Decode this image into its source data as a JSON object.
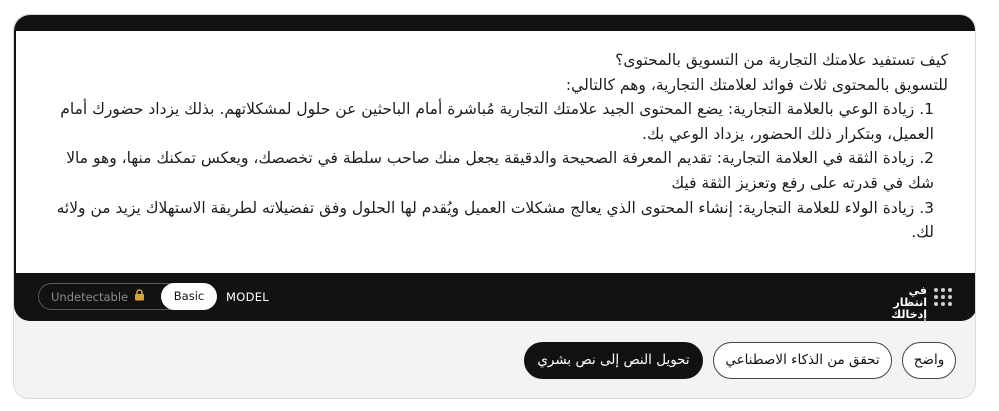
{
  "editor": {
    "paragraphs": [
      "كيف تستفيد علامتك التجارية من التسويق بالمحتوى؟",
      "للتسويق بالمحتوى ثلاث فوائد لعلامتك التجارية، وهم كالتالي:",
      "1. زيادة الوعي بالعلامة التجارية: يضع المحتوى الجيد علامتك التجارية مُباشرة أمام الباحثين عن حلول لمشكلاتهم. بذلك يزداد حضورك أمام العميل، وبتكرار ذلك الحضور، يزداد الوعي بك.",
      "2. زيادة الثقة في العلامة التجارية: تقديم المعرفة الصحيحة والدقيقة يجعل منك صاحب سلطة في تخصصك، ويعكس تمكنك منها، وهو مالا شك في قدرته على رفع وتعزيز الثقة فيك",
      "3. زيادة الولاء للعلامة التجارية: إنشاء المحتوى الذي يعالج مشكلات العميل ويُقدم لها الحلول وفق تفضيلاته لطريقة الاستهلاك يزيد من ولائه لك."
    ]
  },
  "toolbar": {
    "mode_off_label": "Undetectable",
    "mode_on_label": "Basic",
    "model_label": "MODEL",
    "status_line1": "في انتظار",
    "status_line2": "إدخالك",
    "lock_icon": "lock-icon",
    "grid_icon": "grid-icon"
  },
  "actions": {
    "humanize_label": "تحويل النص إلى نص بشري",
    "detect_label": "تحقق من الذكاء الاصطناعي",
    "clear_label": "واضح"
  },
  "colors": {
    "editor_dark": "#121212",
    "panel_bg": "#f3f3f3",
    "primary_button": "#111111",
    "lock_icon": "#d4a53a"
  }
}
